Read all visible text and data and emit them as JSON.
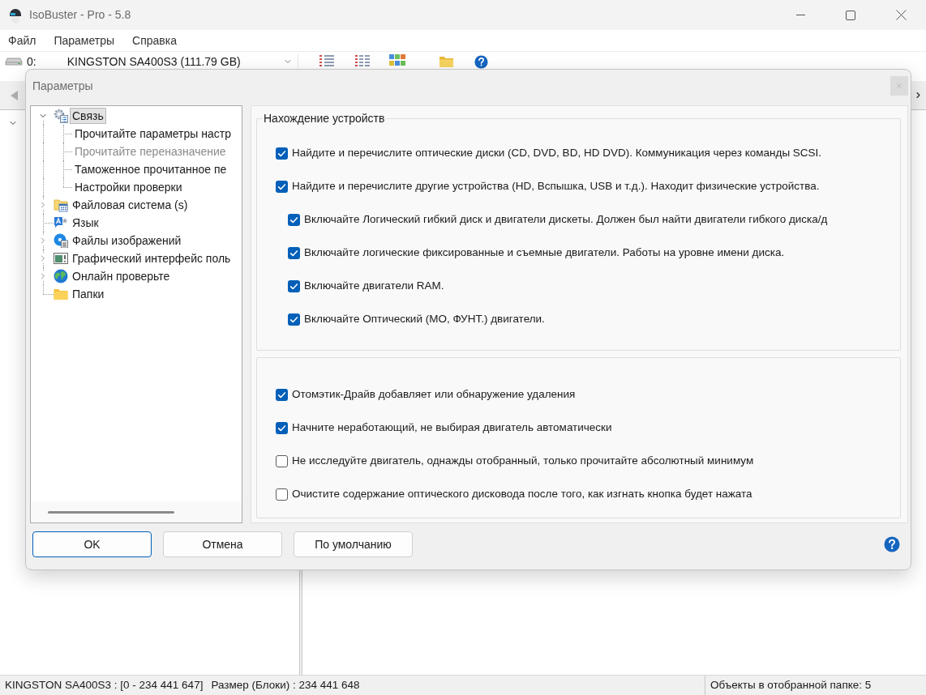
{
  "window": {
    "title": "IsoBuster - Pro - 5.8"
  },
  "menu": [
    "Файл",
    "Параметры",
    "Справка"
  ],
  "toolbar": {
    "drive": {
      "index": "0:",
      "name": "KINGSTON SA400S3 (111.79 GB)"
    }
  },
  "dialog": {
    "title": "Параметры",
    "tree": [
      {
        "label": "Связь",
        "selected": true,
        "expanded": true,
        "children": [
          {
            "label": "Прочитайте параметры настр",
            "selected": false,
            "disabled": false
          },
          {
            "label": "Прочитайте переназначение",
            "selected": false,
            "disabled": true
          },
          {
            "label": "Таможенное прочитанное пе",
            "selected": false,
            "disabled": false
          },
          {
            "label": "Настройки проверки",
            "selected": false,
            "disabled": false
          }
        ]
      },
      {
        "label": "Файловая система (s)",
        "selected": false,
        "expanded": false
      },
      {
        "label": "Язык",
        "selected": false
      },
      {
        "label": "Файлы изображений",
        "selected": false,
        "expanded": false
      },
      {
        "label": "Графический интерфейс поль",
        "selected": false,
        "expanded": false
      },
      {
        "label": "Онлайн проверьте",
        "selected": false,
        "expanded": false
      },
      {
        "label": "Папки",
        "selected": false
      }
    ],
    "device_group": {
      "title": "Нахождение устройств",
      "options": [
        {
          "label": "Найдите и перечислите оптические диски (CD, DVD, BD, HD DVD). Коммуникация через команды SCSI.",
          "checked": true
        },
        {
          "label": "Найдите и перечислите другие устройства (HD, Вспышка, USB и т.д.). Находит физические устройства.",
          "checked": true,
          "children": [
            {
              "label": "Включайте Логический гибкий диск и двигатели дискеты. Должен был найти двигатели гибкого диска/д",
              "checked": true
            },
            {
              "label": "Включайте логические фиксированные и съемные двигатели. Работы на уровне имени диска.",
              "checked": true
            },
            {
              "label": "Включайте двигатели RAM.",
              "checked": true
            },
            {
              "label": "Включайте Оптический (МО, ФУНТ.) двигатели.",
              "checked": true
            }
          ]
        }
      ]
    },
    "options_group": {
      "options": [
        {
          "label": "Отомэтик-Драйв добавляет или обнаружение удаления",
          "checked": true
        },
        {
          "label": "Начните неработающий, не выбирая двигатель автоматически",
          "checked": true
        },
        {
          "label": "Не исследуйте двигатель, однажды отобранный, только прочитайте абсолютный минимум",
          "checked": false
        },
        {
          "label": "Очистите содержание оптического дисковода после того, как изгнать кнопка будет нажата",
          "checked": false
        }
      ]
    },
    "buttons": [
      {
        "label": "OK",
        "default": true
      },
      {
        "label": "Отмена",
        "default": false
      },
      {
        "label": "По умолчанию",
        "default": false
      }
    ]
  },
  "status_bar": {
    "range": "KINGSTON SA400S3 : [0 - 234 441 647]",
    "size": "Размер (Блоки) : 234 441 648",
    "objects": "Объекты в отобранной папке: 5"
  }
}
